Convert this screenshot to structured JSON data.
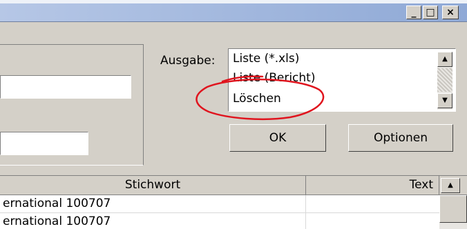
{
  "window": {
    "controls": {
      "minimize_icon": "_",
      "maximize_icon": "□",
      "close_icon": "×"
    }
  },
  "output": {
    "label": "Ausgabe:",
    "options": [
      "Liste (*.xls)",
      "Liste (Bericht)",
      "Löschen"
    ],
    "scroll_up_icon": "▲",
    "scroll_down_icon": "▼"
  },
  "buttons": {
    "ok": "OK",
    "options": "Optionen"
  },
  "table": {
    "columns": [
      "Stichwort",
      "Text"
    ],
    "sort_icon": "▲",
    "rows": [
      {
        "stichwort": "ernational 100707",
        "text": ""
      },
      {
        "stichwort": "ernational 100707",
        "text": ""
      }
    ]
  },
  "colors": {
    "window_bg": "#d4d0c8",
    "titlebar_start": "#b6c7e6",
    "titlebar_end": "#8fa9d6",
    "annotation_circle": "#e0141e"
  }
}
